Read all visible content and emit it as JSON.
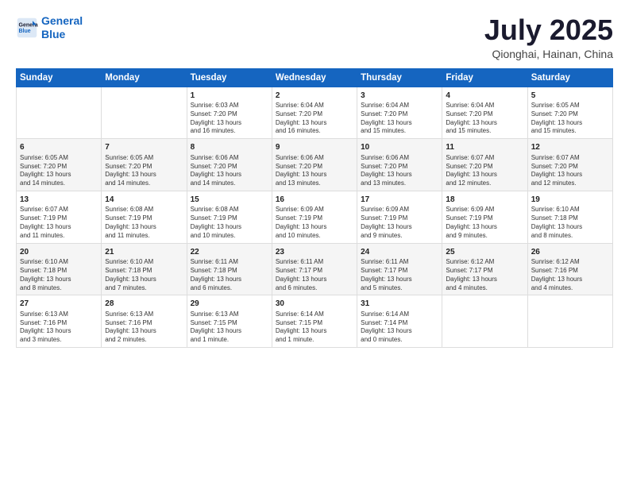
{
  "header": {
    "logo_line1": "General",
    "logo_line2": "Blue",
    "title": "July 2025",
    "subtitle": "Qionghai, Hainan, China"
  },
  "days_of_week": [
    "Sunday",
    "Monday",
    "Tuesday",
    "Wednesday",
    "Thursday",
    "Friday",
    "Saturday"
  ],
  "weeks": [
    [
      {
        "num": "",
        "info": ""
      },
      {
        "num": "",
        "info": ""
      },
      {
        "num": "1",
        "info": "Sunrise: 6:03 AM\nSunset: 7:20 PM\nDaylight: 13 hours\nand 16 minutes."
      },
      {
        "num": "2",
        "info": "Sunrise: 6:04 AM\nSunset: 7:20 PM\nDaylight: 13 hours\nand 16 minutes."
      },
      {
        "num": "3",
        "info": "Sunrise: 6:04 AM\nSunset: 7:20 PM\nDaylight: 13 hours\nand 15 minutes."
      },
      {
        "num": "4",
        "info": "Sunrise: 6:04 AM\nSunset: 7:20 PM\nDaylight: 13 hours\nand 15 minutes."
      },
      {
        "num": "5",
        "info": "Sunrise: 6:05 AM\nSunset: 7:20 PM\nDaylight: 13 hours\nand 15 minutes."
      }
    ],
    [
      {
        "num": "6",
        "info": "Sunrise: 6:05 AM\nSunset: 7:20 PM\nDaylight: 13 hours\nand 14 minutes."
      },
      {
        "num": "7",
        "info": "Sunrise: 6:05 AM\nSunset: 7:20 PM\nDaylight: 13 hours\nand 14 minutes."
      },
      {
        "num": "8",
        "info": "Sunrise: 6:06 AM\nSunset: 7:20 PM\nDaylight: 13 hours\nand 14 minutes."
      },
      {
        "num": "9",
        "info": "Sunrise: 6:06 AM\nSunset: 7:20 PM\nDaylight: 13 hours\nand 13 minutes."
      },
      {
        "num": "10",
        "info": "Sunrise: 6:06 AM\nSunset: 7:20 PM\nDaylight: 13 hours\nand 13 minutes."
      },
      {
        "num": "11",
        "info": "Sunrise: 6:07 AM\nSunset: 7:20 PM\nDaylight: 13 hours\nand 12 minutes."
      },
      {
        "num": "12",
        "info": "Sunrise: 6:07 AM\nSunset: 7:20 PM\nDaylight: 13 hours\nand 12 minutes."
      }
    ],
    [
      {
        "num": "13",
        "info": "Sunrise: 6:07 AM\nSunset: 7:19 PM\nDaylight: 13 hours\nand 11 minutes."
      },
      {
        "num": "14",
        "info": "Sunrise: 6:08 AM\nSunset: 7:19 PM\nDaylight: 13 hours\nand 11 minutes."
      },
      {
        "num": "15",
        "info": "Sunrise: 6:08 AM\nSunset: 7:19 PM\nDaylight: 13 hours\nand 10 minutes."
      },
      {
        "num": "16",
        "info": "Sunrise: 6:09 AM\nSunset: 7:19 PM\nDaylight: 13 hours\nand 10 minutes."
      },
      {
        "num": "17",
        "info": "Sunrise: 6:09 AM\nSunset: 7:19 PM\nDaylight: 13 hours\nand 9 minutes."
      },
      {
        "num": "18",
        "info": "Sunrise: 6:09 AM\nSunset: 7:19 PM\nDaylight: 13 hours\nand 9 minutes."
      },
      {
        "num": "19",
        "info": "Sunrise: 6:10 AM\nSunset: 7:18 PM\nDaylight: 13 hours\nand 8 minutes."
      }
    ],
    [
      {
        "num": "20",
        "info": "Sunrise: 6:10 AM\nSunset: 7:18 PM\nDaylight: 13 hours\nand 8 minutes."
      },
      {
        "num": "21",
        "info": "Sunrise: 6:10 AM\nSunset: 7:18 PM\nDaylight: 13 hours\nand 7 minutes."
      },
      {
        "num": "22",
        "info": "Sunrise: 6:11 AM\nSunset: 7:18 PM\nDaylight: 13 hours\nand 6 minutes."
      },
      {
        "num": "23",
        "info": "Sunrise: 6:11 AM\nSunset: 7:17 PM\nDaylight: 13 hours\nand 6 minutes."
      },
      {
        "num": "24",
        "info": "Sunrise: 6:11 AM\nSunset: 7:17 PM\nDaylight: 13 hours\nand 5 minutes."
      },
      {
        "num": "25",
        "info": "Sunrise: 6:12 AM\nSunset: 7:17 PM\nDaylight: 13 hours\nand 4 minutes."
      },
      {
        "num": "26",
        "info": "Sunrise: 6:12 AM\nSunset: 7:16 PM\nDaylight: 13 hours\nand 4 minutes."
      }
    ],
    [
      {
        "num": "27",
        "info": "Sunrise: 6:13 AM\nSunset: 7:16 PM\nDaylight: 13 hours\nand 3 minutes."
      },
      {
        "num": "28",
        "info": "Sunrise: 6:13 AM\nSunset: 7:16 PM\nDaylight: 13 hours\nand 2 minutes."
      },
      {
        "num": "29",
        "info": "Sunrise: 6:13 AM\nSunset: 7:15 PM\nDaylight: 13 hours\nand 1 minute."
      },
      {
        "num": "30",
        "info": "Sunrise: 6:14 AM\nSunset: 7:15 PM\nDaylight: 13 hours\nand 1 minute."
      },
      {
        "num": "31",
        "info": "Sunrise: 6:14 AM\nSunset: 7:14 PM\nDaylight: 13 hours\nand 0 minutes."
      },
      {
        "num": "",
        "info": ""
      },
      {
        "num": "",
        "info": ""
      }
    ]
  ]
}
